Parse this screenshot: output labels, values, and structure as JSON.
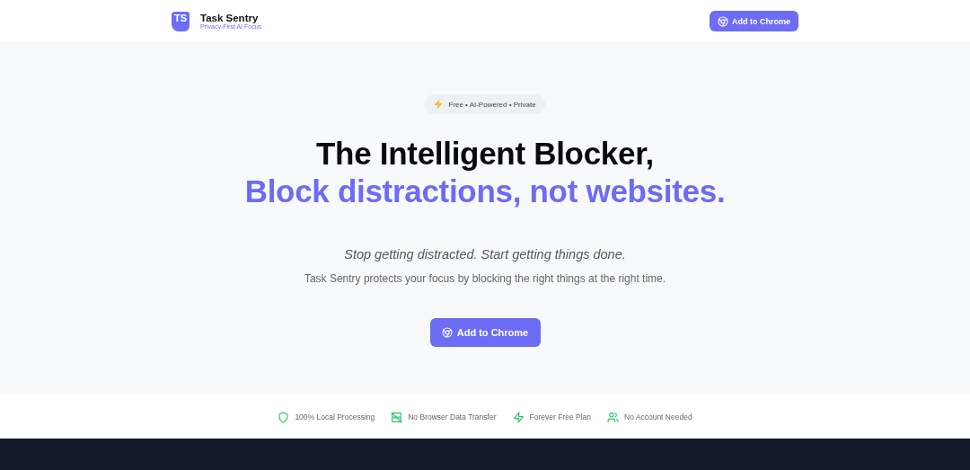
{
  "header": {
    "logo_text": "TS",
    "brand": "Task Sentry",
    "tagline": "Privacy-First AI Focus",
    "cta": "Add to Chrome"
  },
  "hero": {
    "badge": "Free • AI-Powered • Private",
    "title": "The Intelligent Blocker,",
    "title_accent": "Block distractions, not websites.",
    "subtitle": "Stop getting distracted. Start getting things done.",
    "description": "Task Sentry protects your focus by blocking the right things at the right time.",
    "cta": "Add to Chrome"
  },
  "features": [
    {
      "kind": "shield",
      "label": "100% Local Processing"
    },
    {
      "kind": "server-off",
      "label": "No Browser Data Transfer"
    },
    {
      "kind": "zap",
      "label": "Forever Free Plan"
    },
    {
      "kind": "users",
      "label": "No Account Needed"
    }
  ]
}
